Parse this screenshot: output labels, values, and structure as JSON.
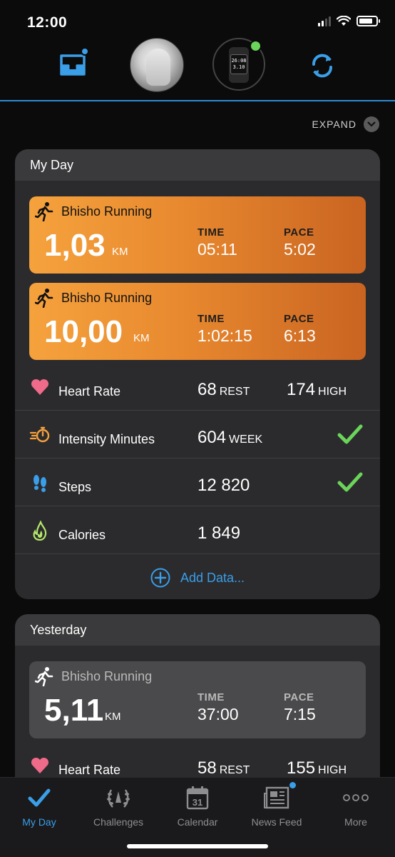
{
  "status_bar": {
    "time": "12:00"
  },
  "header": {
    "inbox_icon": "inbox-icon",
    "sync_icon": "sync-icon",
    "device_watch_text": [
      "26:08",
      "3.10"
    ]
  },
  "expand": {
    "label": "EXPAND"
  },
  "my_day": {
    "title": "My Day",
    "activities": [
      {
        "title": "Bhisho Running",
        "distance": "1,03",
        "unit": "KM",
        "time_label": "TIME",
        "time": "05:11",
        "pace_label": "PACE",
        "pace": "5:02"
      },
      {
        "title": "Bhisho Running",
        "distance": "10,00",
        "unit": "KM",
        "time_label": "TIME",
        "time": "1:02:15",
        "pace_label": "PACE",
        "pace": "6:13"
      }
    ],
    "metrics": {
      "heart_rate": {
        "label": "Heart Rate",
        "rest_value": "68",
        "rest_unit": "REST",
        "high_value": "174",
        "high_unit": "HIGH"
      },
      "intensity": {
        "label": "Intensity Minutes",
        "value": "604",
        "unit": "WEEK"
      },
      "steps": {
        "label": "Steps",
        "value": "12 820"
      },
      "calories": {
        "label": "Calories",
        "value": "1 849"
      }
    },
    "add_data": "Add Data..."
  },
  "yesterday": {
    "title": "Yesterday",
    "activity": {
      "title": "Bhisho Running",
      "distance": "5,11",
      "unit": "KM",
      "time_label": "TIME",
      "time": "37:00",
      "pace_label": "PACE",
      "pace": "7:15"
    },
    "heart_rate": {
      "label": "Heart Rate",
      "rest_value": "58",
      "rest_unit": "REST",
      "high_value": "155",
      "high_unit": "HIGH"
    }
  },
  "tabs": [
    {
      "label": "My Day",
      "icon": "check-icon",
      "active": true
    },
    {
      "label": "Challenges",
      "icon": "laurel-icon"
    },
    {
      "label": "Calendar",
      "icon": "calendar-icon",
      "day": "31"
    },
    {
      "label": "News Feed",
      "icon": "newspaper-icon"
    },
    {
      "label": "More",
      "icon": "more-icon"
    }
  ],
  "colors": {
    "accent": "#3a9ee8",
    "activity_orange": "#e8892f",
    "check_green": "#6bd45a",
    "heart_pink": "#f06a8a"
  }
}
